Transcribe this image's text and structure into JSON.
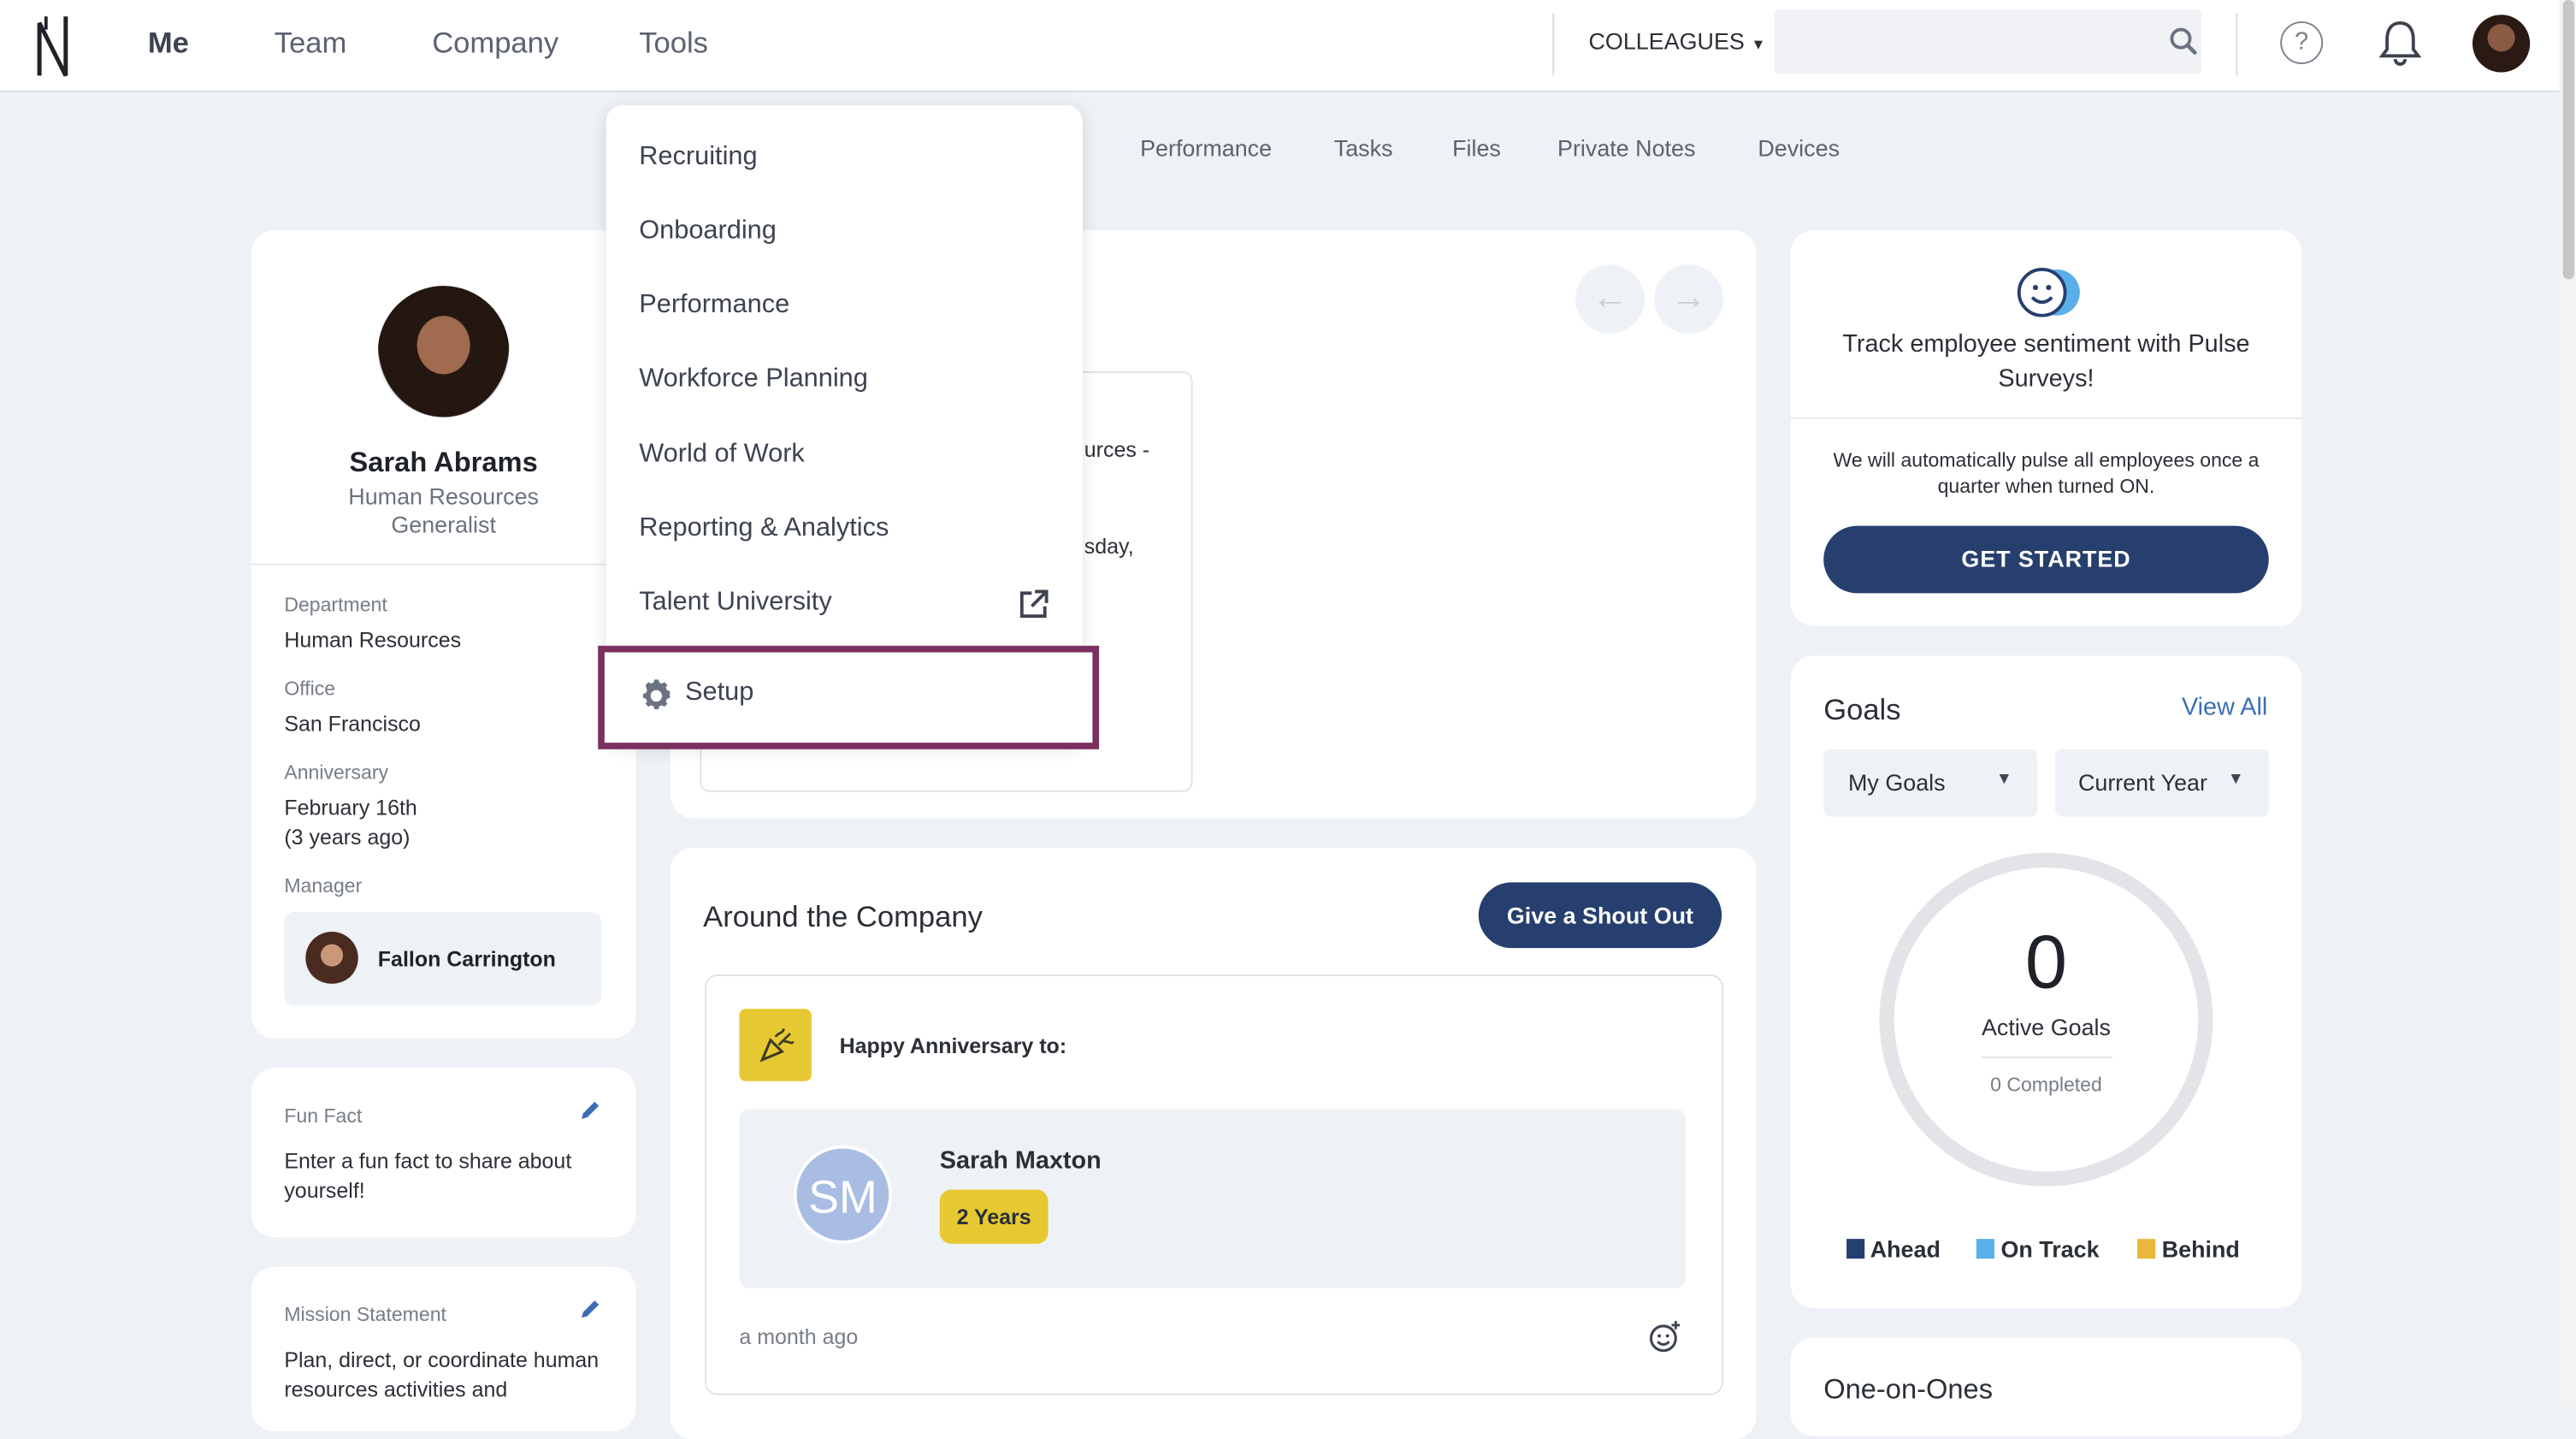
{
  "colors": {
    "accent": "#263f6e",
    "highlight": "#7a3160",
    "anniversary": "#e6c932",
    "ahead": "#263f6e",
    "on_track": "#5aafea",
    "behind": "#e8b73c"
  },
  "topnav": {
    "tabs": [
      "Me",
      "Team",
      "Company",
      "Tools"
    ],
    "colleagues_label": "COLLEAGUES",
    "search_placeholder": ""
  },
  "subtabs": [
    "Performance",
    "Tasks",
    "Files",
    "Private Notes",
    "Devices"
  ],
  "tools_menu": {
    "items": [
      "Recruiting",
      "Onboarding",
      "Performance",
      "Workforce Planning",
      "World of Work",
      "Reporting & Analytics",
      "Talent University"
    ],
    "setup_label": "Setup"
  },
  "profile": {
    "name": "Sarah Abrams",
    "title": "Human Resources Generalist",
    "department_label": "Department",
    "department": "Human Resources",
    "office_label": "Office",
    "office": "San Francisco",
    "anniversary_label": "Anniversary",
    "anniversary": "February 16th",
    "anniversary_ago": "(3 years ago)",
    "manager_label": "Manager",
    "manager": "Fallon Carrington"
  },
  "fun_fact": {
    "label": "Fun Fact",
    "text": "Enter a fun fact to share about yourself!"
  },
  "mission": {
    "label": "Mission Statement",
    "text": "Plan, direct, or coordinate human resources activities and"
  },
  "announcement_fragments": {
    "line1": "urces -",
    "line2": "sday,"
  },
  "around_company": {
    "title": "Around the Company",
    "shout_out_label": "Give a Shout Out",
    "event_title": "Happy Anniversary to:",
    "person_initials": "SM",
    "person_name": "Sarah Maxton",
    "years_badge": "2 Years",
    "time_ago": "a month ago"
  },
  "pulse": {
    "headline": "Track employee sentiment with Pulse Surveys!",
    "description": "We will automatically pulse all employees once a quarter when turned ON.",
    "button": "GET STARTED"
  },
  "goals": {
    "title": "Goals",
    "view_all": "View All",
    "filter1": "My Goals",
    "filter2": "Current Year",
    "active_count": "0",
    "active_label": "Active Goals",
    "completed": "0 Completed",
    "legend": [
      "Ahead",
      "On Track",
      "Behind"
    ]
  },
  "one_on_ones": {
    "title": "One-on-Ones"
  }
}
